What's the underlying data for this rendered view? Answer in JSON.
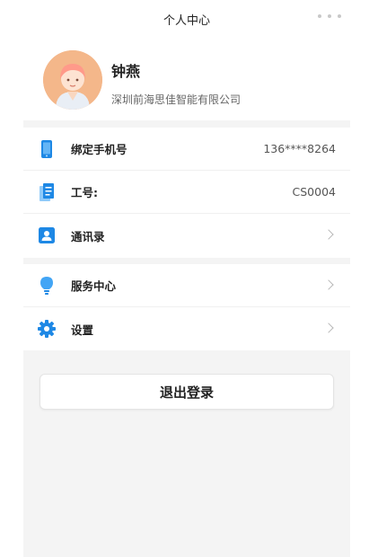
{
  "header": {
    "title": "个人中心",
    "more_icon": "more-dots-icon"
  },
  "profile": {
    "name": "钟燕",
    "company": "深圳前海思佳智能有限公司",
    "avatar_icon": "avatar-girl-icon"
  },
  "info_items": [
    {
      "label": "绑定手机号",
      "value": "136****8264",
      "icon": "phone-icon",
      "icon_color": "#1e88e5"
    },
    {
      "label": "工号:",
      "value": "CS0004",
      "icon": "document-icon",
      "icon_color": "#1e88e5"
    },
    {
      "label": "通讯录",
      "value": "",
      "icon": "contacts-icon",
      "icon_color": "#1e88e5"
    }
  ],
  "menu_items": [
    {
      "label": "服务中心",
      "icon": "lightbulb-icon",
      "icon_color": "#42a5f5"
    },
    {
      "label": "设置",
      "icon": "gear-icon",
      "icon_color": "#1e88e5"
    }
  ],
  "logout": {
    "label": "退出登录"
  },
  "colors": {
    "background": "#f4f4f4",
    "card": "#ffffff",
    "accent": "#1e88e5",
    "avatar_bg": "#f4b78a"
  }
}
